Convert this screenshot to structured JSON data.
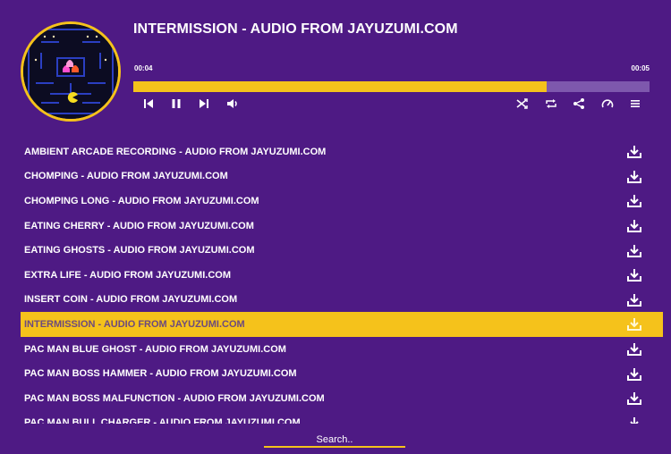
{
  "player": {
    "title": "INTERMISSION - AUDIO FROM JAYUZUMI.COM",
    "current_time": "00:04",
    "duration": "00:05",
    "progress_fraction": 0.8,
    "controls": {
      "previous": "skip-previous-icon",
      "pause": "pause-icon",
      "next": "skip-next-icon",
      "volume": "volume-icon",
      "shuffle": "shuffle-icon",
      "repeat": "repeat-icon",
      "share": "share-icon",
      "speed": "speedometer-icon",
      "playlist": "playlist-menu-icon"
    }
  },
  "playlist": {
    "active_index": 7,
    "tracks": [
      {
        "label": "AMBIENT ARCADE RECORDING - AUDIO FROM JAYUZUMI.COM"
      },
      {
        "label": "CHOMPING - AUDIO FROM JAYUZUMI.COM"
      },
      {
        "label": "CHOMPING LONG - AUDIO FROM JAYUZUMI.COM"
      },
      {
        "label": "EATING CHERRY - AUDIO FROM JAYUZUMI.COM"
      },
      {
        "label": "EATING GHOSTS - AUDIO FROM JAYUZUMI.COM"
      },
      {
        "label": "EXTRA LIFE - AUDIO FROM JAYUZUMI.COM"
      },
      {
        "label": "INSERT COIN - AUDIO FROM JAYUZUMI.COM"
      },
      {
        "label": "INTERMISSION - AUDIO FROM JAYUZUMI.COM"
      },
      {
        "label": "PAC MAN BLUE GHOST - AUDIO FROM JAYUZUMI.COM"
      },
      {
        "label": "PAC MAN BOSS HAMMER - AUDIO FROM JAYUZUMI.COM"
      },
      {
        "label": "PAC MAN BOSS MALFUNCTION - AUDIO FROM JAYUZUMI.COM"
      },
      {
        "label": "PAC MAN BULL CHARGER - AUDIO FROM JAYUZUMI.COM"
      }
    ],
    "download_icon": "download-icon"
  },
  "search": {
    "placeholder": "Search.."
  },
  "colors": {
    "background": "#4e1a84",
    "accent": "#f5c21b",
    "track_rest": "#7e58ad",
    "active_text": "#6c4a7e"
  }
}
